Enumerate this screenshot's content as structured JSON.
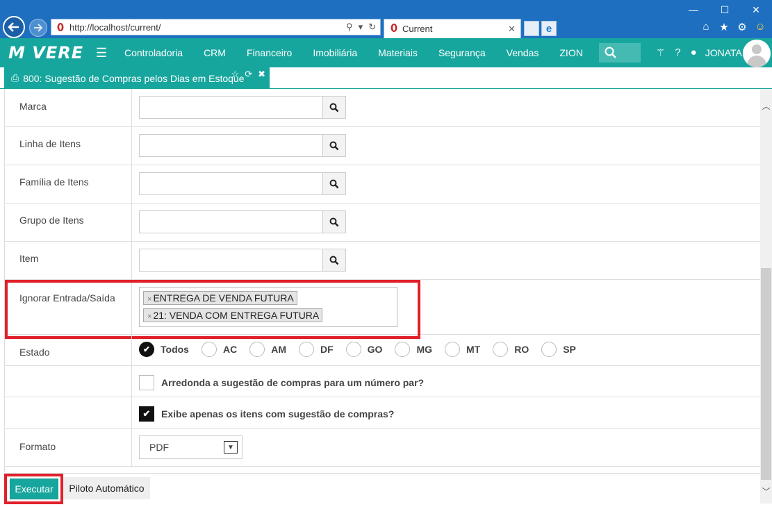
{
  "browser": {
    "url": "http://localhost/current/",
    "tab_title": "Current"
  },
  "header": {
    "logo": "M  VERE",
    "menu": [
      "Controladoria",
      "CRM",
      "Financeiro",
      "Imobiliária",
      "Materiais",
      "Segurança",
      "Vendas",
      "ZION"
    ],
    "user": "JONATAN"
  },
  "page_tab": {
    "title": "800: Sugestão de Compras pelos Dias em Estoque"
  },
  "form": {
    "marca_label": "Marca",
    "linha_label": "Linha de Itens",
    "familia_label": "Família de Itens",
    "grupo_label": "Grupo de Itens",
    "item_label": "Item",
    "ignorar_label": "Ignorar Entrada/Saída",
    "ignorar_tags": [
      "ENTREGA DE VENDA FUTURA",
      "21: VENDA COM ENTREGA FUTURA"
    ],
    "estado_label": "Estado",
    "estado_options": [
      "Todos",
      "AC",
      "AM",
      "DF",
      "GO",
      "MG",
      "MT",
      "RO",
      "SP"
    ],
    "estado_selected": "Todos",
    "arredonda_label": "Arredonda a sugestão de compras para um número par?",
    "arredonda_checked": false,
    "exibe_label": "Exibe apenas os itens com sugestão de compras?",
    "exibe_checked": true,
    "formato_label": "Formato",
    "formato_value": "PDF"
  },
  "footer": {
    "executar": "Executar",
    "piloto": "Piloto Automático"
  },
  "colors": {
    "accent": "#17a69e",
    "highlight": "#e0202a",
    "browser_chrome": "#1e6fbf"
  }
}
